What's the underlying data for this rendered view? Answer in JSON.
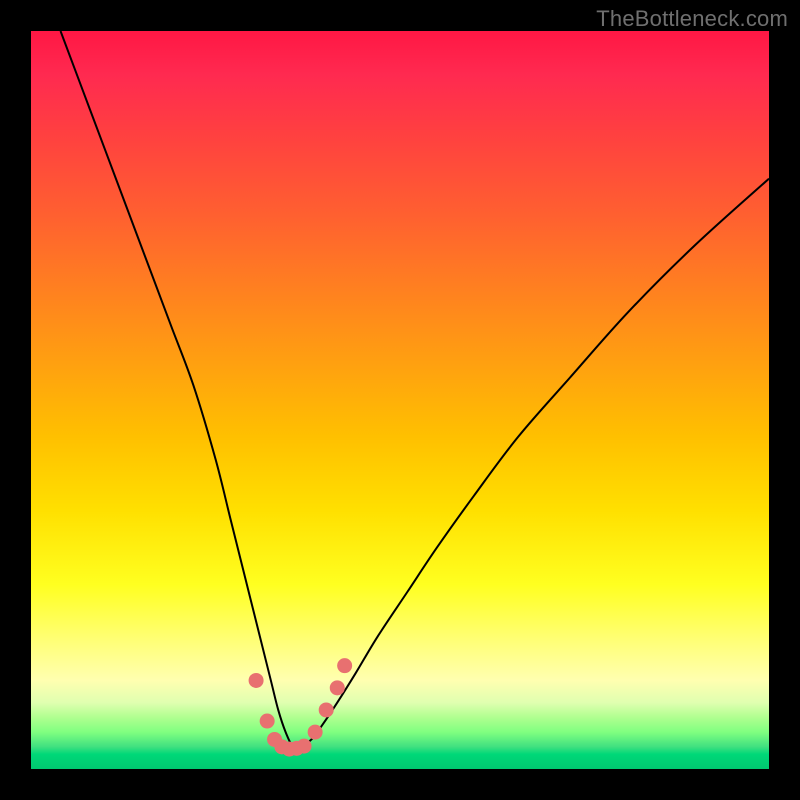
{
  "watermark": "TheBottleneck.com",
  "chart_data": {
    "type": "line",
    "title": "",
    "xlabel": "",
    "ylabel": "",
    "xlim": [
      0,
      100
    ],
    "ylim": [
      0,
      100
    ],
    "series": [
      {
        "name": "bottleneck-curve",
        "x": [
          4,
          7,
          10,
          13,
          16,
          19,
          22,
          25,
          27,
          29,
          31,
          32.5,
          33.5,
          34.5,
          35.5,
          36.5,
          38,
          39.5,
          41.5,
          44,
          47,
          51,
          55,
          60,
          66,
          73,
          81,
          90,
          100
        ],
        "values": [
          100,
          92,
          84,
          76,
          68,
          60,
          52,
          42,
          34,
          26,
          18,
          12,
          8,
          5,
          3,
          3,
          4,
          6,
          9,
          13,
          18,
          24,
          30,
          37,
          45,
          53,
          62,
          71,
          80
        ]
      }
    ],
    "markers": {
      "name": "highlight-dots",
      "color": "#e87070",
      "points_x": [
        30.5,
        32,
        33,
        34,
        35,
        36,
        37,
        38.5,
        40,
        41.5,
        42.5
      ],
      "points_y": [
        12,
        6.5,
        4,
        3,
        2.7,
        2.8,
        3.1,
        5,
        8,
        11,
        14
      ]
    }
  }
}
